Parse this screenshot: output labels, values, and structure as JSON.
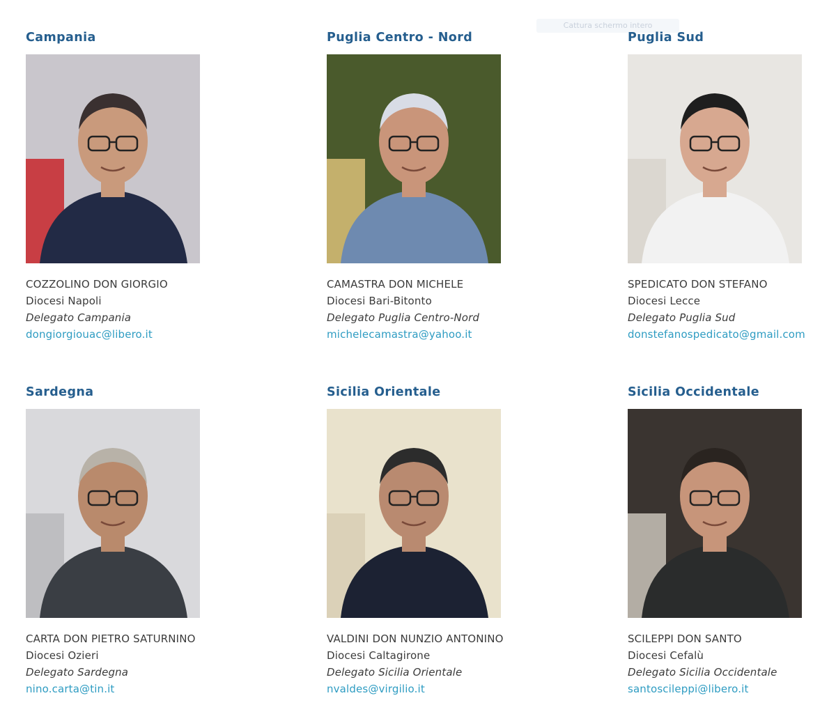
{
  "overlay": {
    "label": "Cattura schermo intero"
  },
  "delegates": [
    {
      "region": "Campania",
      "name": "COZZOLINO DON GIORGIO",
      "diocese": "Diocesi Napoli",
      "role": "Delegato Campania",
      "email": "dongiorgiouac@libero.it"
    },
    {
      "region": "Puglia Centro - Nord",
      "name": "CAMASTRA DON MICHELE",
      "diocese": "Diocesi Bari-Bitonto",
      "role": "Delegato Puglia Centro-Nord",
      "email": "michelecamastra@yahoo.it"
    },
    {
      "region": "Puglia Sud",
      "name": "SPEDICATO DON STEFANO",
      "diocese": "Diocesi Lecce",
      "role": "Delegato Puglia Sud",
      "email": "donstefanospedicato@gmail.com"
    },
    {
      "region": "Sardegna",
      "name": "CARTA DON PIETRO SATURNINO",
      "diocese": "Diocesi Ozieri",
      "role": "Delegato Sardegna",
      "email": "nino.carta@tin.it"
    },
    {
      "region": "Sicilia Orientale",
      "name": "VALDINI DON NUNZIO ANTONINO",
      "diocese": "Diocesi Caltagirone",
      "role": "Delegato Sicilia Orientale",
      "email": "nvaldes@virgilio.it"
    },
    {
      "region": "Sicilia Occidentale",
      "name": "SCILEPPI DON SANTO",
      "diocese": "Diocesi Cefalù",
      "role": "Delegato Sicilia Occidentale",
      "email": "santoscileppi@libero.it"
    }
  ],
  "photo_palettes": [
    {
      "bg": "#c9c6cc",
      "accent": "#c8262c",
      "shirt": "#222a45",
      "skin": "#c99a7c",
      "hair": "#3a3030"
    },
    {
      "bg": "#4a5a2c",
      "accent": "#d9c078",
      "shirt": "#6e8ab0",
      "skin": "#c9957a",
      "hair": "#d8dce6"
    },
    {
      "bg": "#e8e6e2",
      "accent": "#d8d4cc",
      "shirt": "#f2f2f2",
      "skin": "#d7a890",
      "hair": "#1e1e1e"
    },
    {
      "bg": "#d9d9dc",
      "accent": "#b8b8bc",
      "shirt": "#3a3e44",
      "skin": "#b98a6c",
      "hair": "#b8b2a8"
    },
    {
      "bg": "#e9e2cc",
      "accent": "#d8ceb4",
      "shirt": "#1c2233",
      "skin": "#b98a70",
      "hair": "#2c2c2c"
    },
    {
      "bg": "#3a3430",
      "accent": "#c9c3b8",
      "shirt": "#2a2c2c",
      "skin": "#c7957a",
      "hair": "#2a2420"
    }
  ]
}
